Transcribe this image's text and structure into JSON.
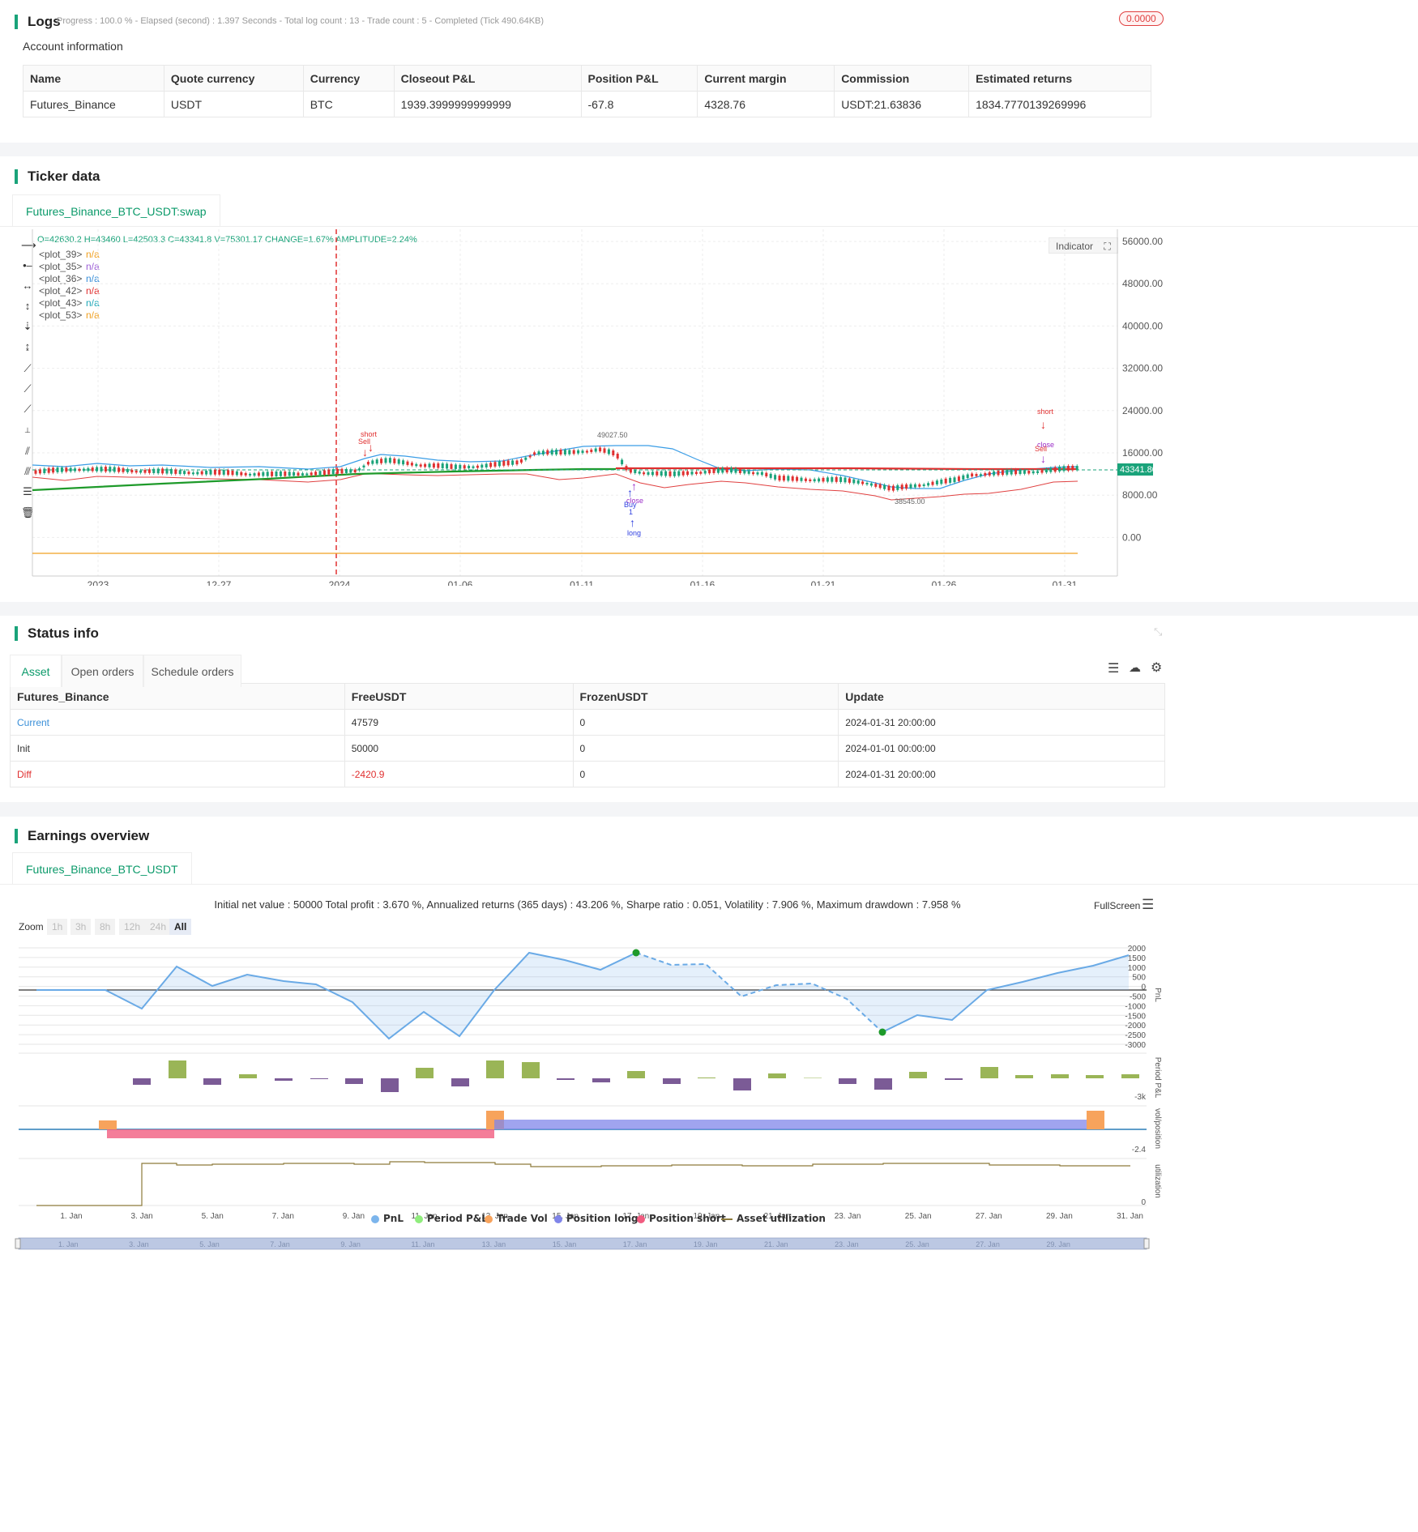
{
  "logs": {
    "title": "Logs",
    "summary": "Progress : 100.0 % - Elapsed (second) : 1.397  Seconds - Total log count : 13 - Trade count : 5 - Completed (Tick 490.64KB)",
    "badge": "0.0000"
  },
  "account": {
    "title": "Account information",
    "headers": [
      "Name",
      "Quote currency",
      "Currency",
      "Closeout P&L",
      "Position P&L",
      "Current margin",
      "Commission",
      "Estimated returns"
    ],
    "row": [
      "Futures_Binance",
      "USDT",
      "BTC",
      "1939.3999999999999",
      "-67.8",
      "4328.76",
      "USDT:21.63836",
      "1834.7770139269996"
    ]
  },
  "ticker": {
    "title": "Ticker data",
    "tab": "Futures_Binance_BTC_USDT:swap",
    "ohlc": "O=42630.2 H=43460 L=42503.3 C=43341.8 V=75301.17 CHANGE=1.67% AMPLITUDE=2.24%",
    "legend": [
      {
        "name": "<plot_39>",
        "value": "n/a",
        "color": "#f0a020"
      },
      {
        "name": "<plot_35>",
        "value": "n/a",
        "color": "#9c5fd6"
      },
      {
        "name": "<plot_36>",
        "value": "n/a",
        "color": "#3a8fd8"
      },
      {
        "name": "<plot_42>",
        "value": "n/a",
        "color": "#e03030"
      },
      {
        "name": "<plot_43>",
        "value": "n/a",
        "color": "#20a8b8"
      },
      {
        "name": "<plot_53>",
        "value": "n/a",
        "color": "#f0a020"
      }
    ],
    "indicator_btn": "Indicator",
    "price_ticks": [
      "56000.00",
      "48000.00",
      "40000.00",
      "32000.00",
      "24000.00",
      "16000.00",
      "8000.00",
      "0.00"
    ],
    "date_ticks": [
      "2023",
      "12-27",
      "2024",
      "01-06",
      "01-11",
      "01-16",
      "01-21",
      "01-26",
      "01-31"
    ],
    "last_price": "43341.80",
    "high_label": "49027.50",
    "low_label": "38545.00",
    "markers": {
      "short": "short",
      "sell": "Sell",
      "buy": "Buy",
      "long": "long",
      "close": "close",
      "one": "1"
    }
  },
  "status": {
    "title": "Status info",
    "tabs": [
      "Asset",
      "Open orders",
      "Schedule orders"
    ],
    "headers": [
      "Futures_Binance",
      "FreeUSDT",
      "FrozenUSDT",
      "Update"
    ],
    "rows": [
      [
        "Current",
        "47579",
        "0",
        "2024-01-31 20:00:00"
      ],
      [
        "Init",
        "50000",
        "0",
        "2024-01-01 00:00:00"
      ],
      [
        "Diff",
        "-2420.9",
        "0",
        "2024-01-31 20:00:00"
      ]
    ]
  },
  "earnings": {
    "title": "Earnings overview",
    "tab": "Futures_Binance_BTC_USDT",
    "summary": "Initial net value : 50000 Total profit : 3.670 %, Annualized returns (365 days) : 43.206 %, Sharpe ratio : 0.051, Volatility : 7.906 %, Maximum drawdown : 7.958 %",
    "fullscreen": "FullScreen",
    "zoom_label": "Zoom",
    "zoom_opts": [
      "1h",
      "3h",
      "8h",
      "12h",
      "24h",
      "All"
    ],
    "pnl_ticks": [
      "2000",
      "1500",
      "1000",
      "500",
      "0",
      "-500",
      "-1000",
      "-1500",
      "-2000",
      "-2500",
      "-3000"
    ],
    "axis_titles": [
      "PnL",
      "Period P&L",
      "vol/position",
      "utilization"
    ],
    "period_tick": "-3k",
    "vol_tick": "-2.4",
    "util_tick": "0",
    "date_ticks": [
      "1. Jan",
      "3. Jan",
      "5. Jan",
      "7. Jan",
      "9. Jan",
      "11. Jan",
      "13. Jan",
      "15. Jan",
      "17. Jan",
      "19. Jan",
      "21. Jan",
      "23. Jan",
      "25. Jan",
      "27. Jan",
      "29. Jan",
      "31. Jan"
    ],
    "legend": [
      {
        "name": "PnL",
        "color": "#7cb5ec"
      },
      {
        "name": "Period P&L",
        "color": "#90ed7d"
      },
      {
        "name": "Trade Vol",
        "color": "#f7a35c"
      },
      {
        "name": "Position long",
        "color": "#8085e9"
      },
      {
        "name": "Position short",
        "color": "#f15c80"
      },
      {
        "name": "Asset utilization",
        "color": "#8d7a3a"
      }
    ],
    "nav_ticks": [
      "1. Jan",
      "3. Jan",
      "5. Jan",
      "7. Jan",
      "9. Jan",
      "11. Jan",
      "13. Jan",
      "15. Jan",
      "17. Jan",
      "19. Jan",
      "21. Jan",
      "23. Jan",
      "25. Jan",
      "27. Jan",
      "29. Jan"
    ]
  }
}
